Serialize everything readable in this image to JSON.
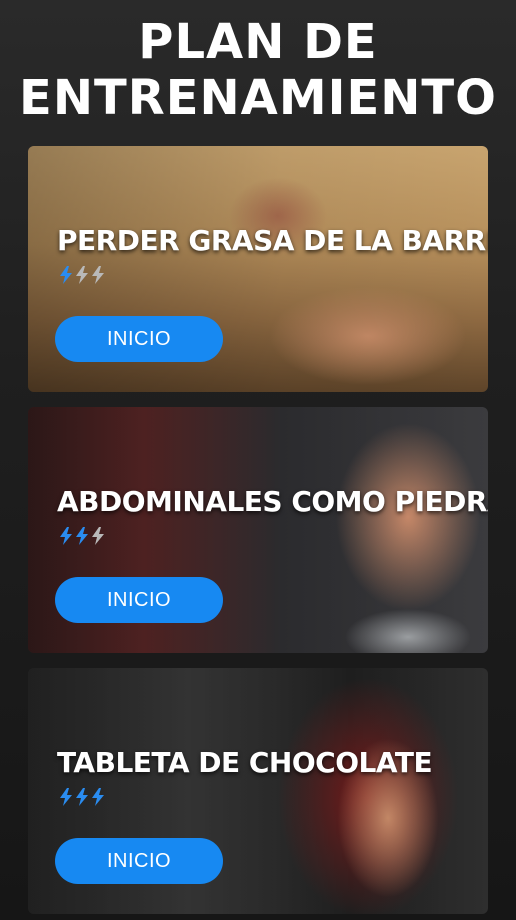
{
  "header": {
    "title_line1": "PLAN DE",
    "title_line2": "ENTRENAMIENTO"
  },
  "plans": [
    {
      "title": "PERDER GRASA DE LA BARRIGA",
      "level": 1,
      "level_max": 3,
      "button_label": "INICIO"
    },
    {
      "title": "ABDOMINALES COMO PIEDRAS",
      "level": 2,
      "level_max": 3,
      "button_label": "INICIO"
    },
    {
      "title": "TABLETA DE CHOCOLATE",
      "level": 3,
      "level_max": 3,
      "button_label": "INICIO"
    }
  ],
  "colors": {
    "accent": "#1789f2",
    "bolt_active": "#2a8cf0",
    "bolt_inactive": "#b9b9b9"
  },
  "icons": {
    "level_icon": "lightning-bolt-icon"
  }
}
